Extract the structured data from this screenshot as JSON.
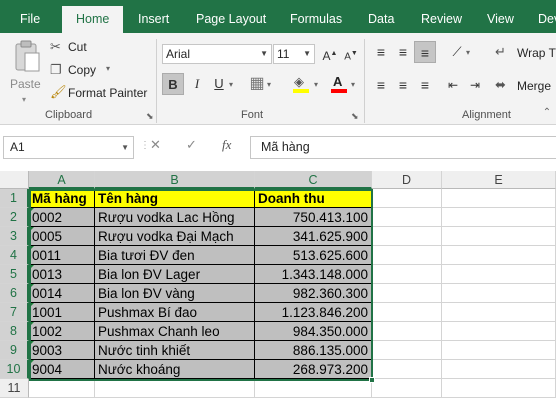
{
  "ribbon": {
    "tabs": [
      "File",
      "Home",
      "Insert",
      "Page Layout",
      "Formulas",
      "Data",
      "Review",
      "View",
      "Dev"
    ],
    "active_tab": "Home",
    "clipboard": {
      "paste": "Paste",
      "cut": "Cut",
      "copy": "Copy",
      "format_painter": "Format Painter",
      "group_label": "Clipboard"
    },
    "font": {
      "name": "Arial",
      "size": "11",
      "group_label": "Font"
    },
    "alignment": {
      "wrap_text": "Wrap T",
      "merge": "Merge",
      "group_label": "Alignment"
    }
  },
  "formula_bar": {
    "name_box": "A1",
    "fx": "fx",
    "cancel": "✕",
    "enter": "✓",
    "value": "Mã hàng"
  },
  "sheet": {
    "columns": [
      "A",
      "B",
      "C",
      "D",
      "E"
    ],
    "rows": [
      "1",
      "2",
      "3",
      "4",
      "5",
      "6",
      "7",
      "8",
      "9",
      "10",
      "11"
    ],
    "header": [
      "Mã hàng",
      "Tên hàng",
      "Doanh thu"
    ],
    "data": [
      [
        "0002",
        "Rượu vodka Lac Hồng",
        "750.413.100"
      ],
      [
        "0005",
        "Rượu vodka Đại Mạch",
        "341.625.900"
      ],
      [
        "0011",
        "Bia tươi ĐV đen",
        "513.625.600"
      ],
      [
        "0013",
        "Bia lon ĐV Lager",
        "1.343.148.000"
      ],
      [
        "0014",
        "Bia lon ĐV vàng",
        "982.360.300"
      ],
      [
        "1001",
        "Pushmax Bí đao",
        "1.123.846.200"
      ],
      [
        "1002",
        "Pushmax Chanh leo",
        "984.350.000"
      ],
      [
        "9003",
        "Nước tinh khiết",
        "886.135.000"
      ],
      [
        "9004",
        "Nước khoáng",
        "268.973.200"
      ]
    ]
  }
}
